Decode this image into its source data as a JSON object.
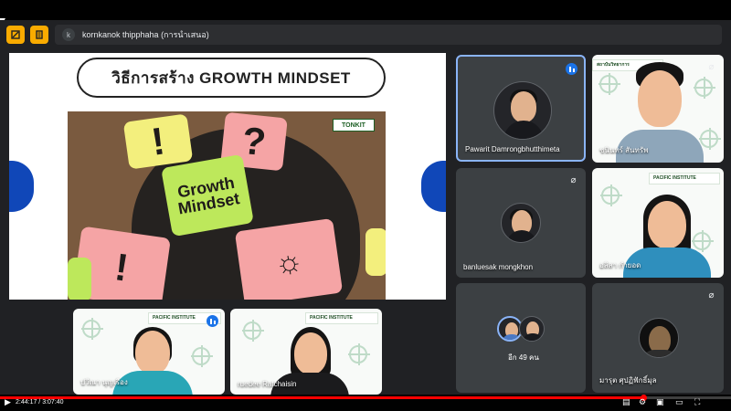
{
  "meet": {
    "presenter_initial": "k",
    "presenter_label": "kornkanok thipphaha (การนำเสนอ)"
  },
  "slide": {
    "title": "วิธีการสร้าง GROWTH MINDSET",
    "logo_text": "TONKIT",
    "note_text": "Growth Mindset",
    "accent_color": "#1047b8"
  },
  "participants": [
    {
      "name": "Pawarit Damrongbhutthimeta",
      "mic": "speaking"
    },
    {
      "name": "ชนินทร์ สันทรัพ",
      "mic": "off"
    },
    {
      "name": "banluesak mongkhon",
      "mic": "off"
    },
    {
      "name": "อลิสา กำยอด",
      "mic": "none"
    },
    {
      "name": "อีก 49 คน",
      "mic": "none"
    },
    {
      "name": "มารุต ศุปฏิฟักธิ์มุล",
      "mic": "off"
    },
    {
      "name": "ปวีณา นุญเรือง",
      "mic": "speaking"
    },
    {
      "name": "ruedee Ratchaisin",
      "mic": "none"
    }
  ],
  "player": {
    "time_current": "2:44:17",
    "time_total": "3:07:40",
    "progress_percent": 88
  }
}
